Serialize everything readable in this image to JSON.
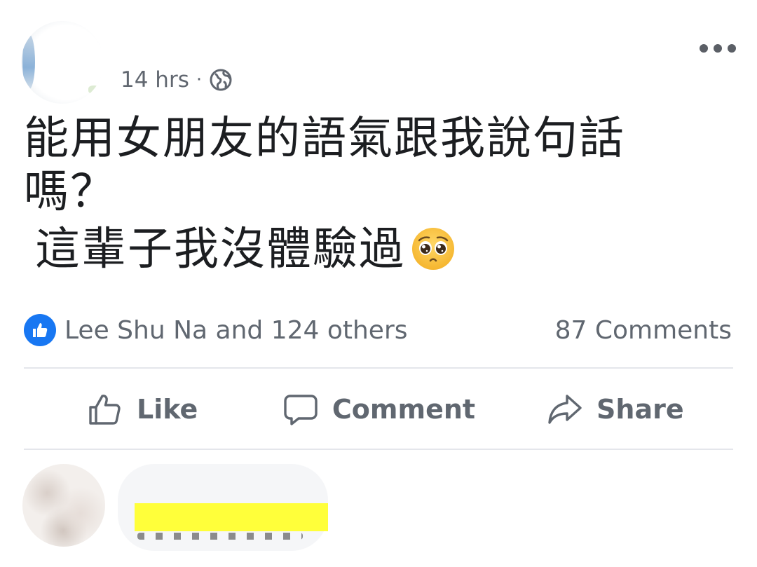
{
  "post": {
    "timestamp": "14 hrs",
    "separator": "·",
    "privacy_icon": "globe-icon",
    "more_icon": "more-options-icon",
    "text_line_1": "能用女朋友的語氣跟我說句話",
    "text_line_1b": "嗎？",
    "text_line_2": "這輩子我沒體驗過",
    "emoji": "pleading-face-emoji"
  },
  "reactions": {
    "summary": "Lee Shu Na and 124 others",
    "comments": "87 Comments"
  },
  "actions": {
    "like": "Like",
    "comment": "Comment",
    "share": "Share"
  },
  "colors": {
    "like_blue": "#1877f2",
    "muted_text": "#606770",
    "redaction_yellow": "#ffff3a"
  }
}
